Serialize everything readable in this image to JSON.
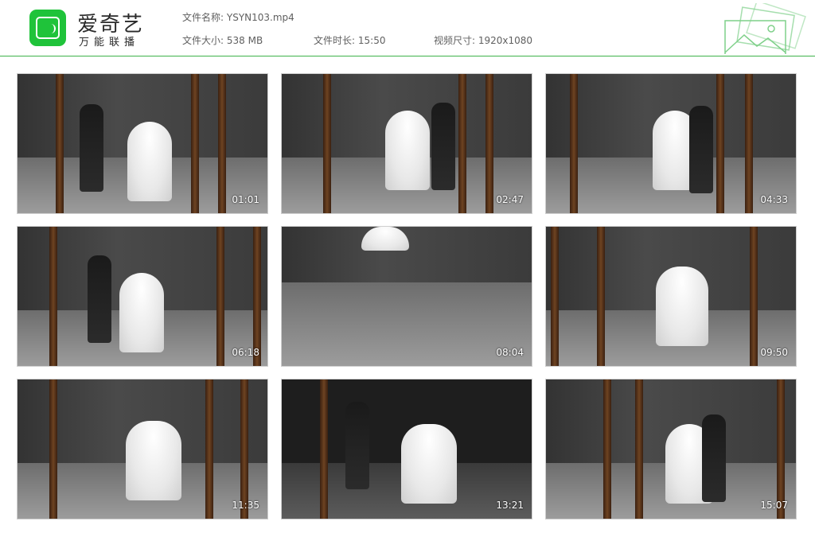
{
  "app": {
    "title": "爱奇艺",
    "subtitle": "万能联播",
    "brand_color": "#1fc33a",
    "accent_line_color": "#3fb24a"
  },
  "file_info": {
    "name_label": "文件名称:",
    "name_value": "YSYN103.mp4",
    "size_label": "文件大小:",
    "size_value": "538 MB",
    "duration_label": "文件时长:",
    "duration_value": "15:50",
    "resolution_label": "视频尺寸:",
    "resolution_value": "1920x1080"
  },
  "thumbnails": [
    {
      "time": "01:01"
    },
    {
      "time": "02:47"
    },
    {
      "time": "04:33"
    },
    {
      "time": "06:18"
    },
    {
      "time": "08:04"
    },
    {
      "time": "09:50"
    },
    {
      "time": "11:35"
    },
    {
      "time": "13:21"
    },
    {
      "time": "15:07"
    }
  ]
}
